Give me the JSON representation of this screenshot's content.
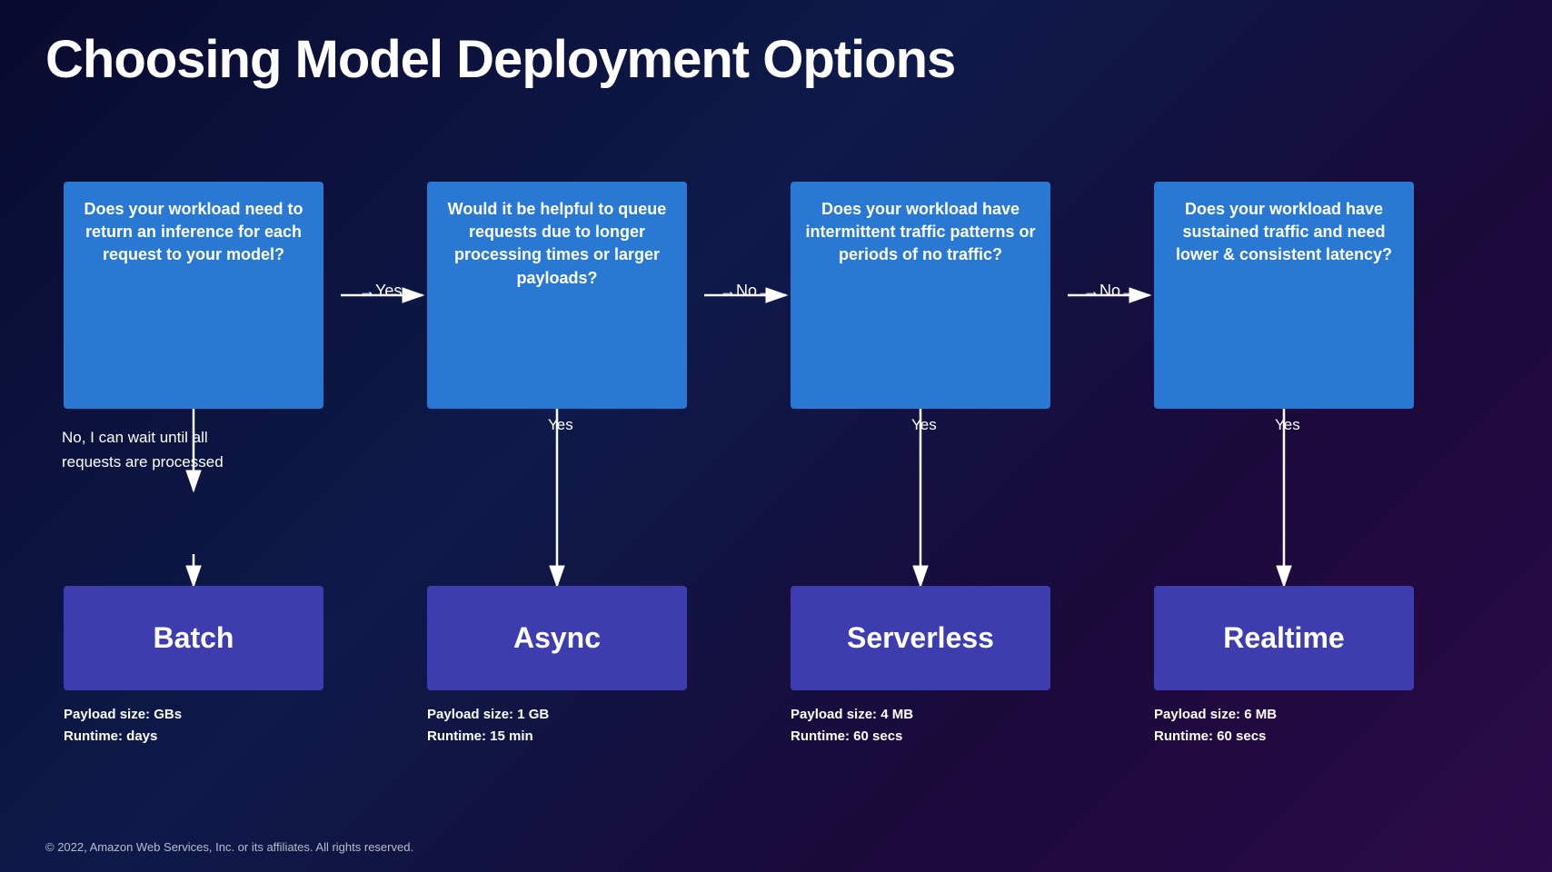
{
  "title": "Choosing Model Deployment Options",
  "questions": [
    {
      "id": "q1",
      "text": "Does your workload need to return an inference for each request to your model?"
    },
    {
      "id": "q2",
      "text": "Would it be helpful to queue requests due to longer processing times or larger payloads?"
    },
    {
      "id": "q3",
      "text": "Does your workload have intermittent traffic patterns or periods of no traffic?"
    },
    {
      "id": "q4",
      "text": "Does your workload have sustained traffic and need lower & consistent latency?"
    }
  ],
  "results": [
    {
      "id": "batch",
      "label": "Batch",
      "payload": "Payload size: GBs",
      "runtime": "Runtime: days"
    },
    {
      "id": "async",
      "label": "Async",
      "payload": "Payload size: 1 GB",
      "runtime": "Runtime: 15 min"
    },
    {
      "id": "serverless",
      "label": "Serverless",
      "payload": "Payload size: 4 MB",
      "runtime": "Runtime: 60 secs"
    },
    {
      "id": "realtime",
      "label": "Realtime",
      "payload": "Payload size: 6 MB",
      "runtime": "Runtime: 60 secs"
    }
  ],
  "no_path_label": "No, I can wait until all\nrequests are processed",
  "yes_labels": [
    "Yes",
    "Yes",
    "Yes",
    "Yes"
  ],
  "no_labels": [
    "No",
    "No"
  ],
  "footer": "© 2022, Amazon Web Services, Inc. or its affiliates. All rights reserved."
}
